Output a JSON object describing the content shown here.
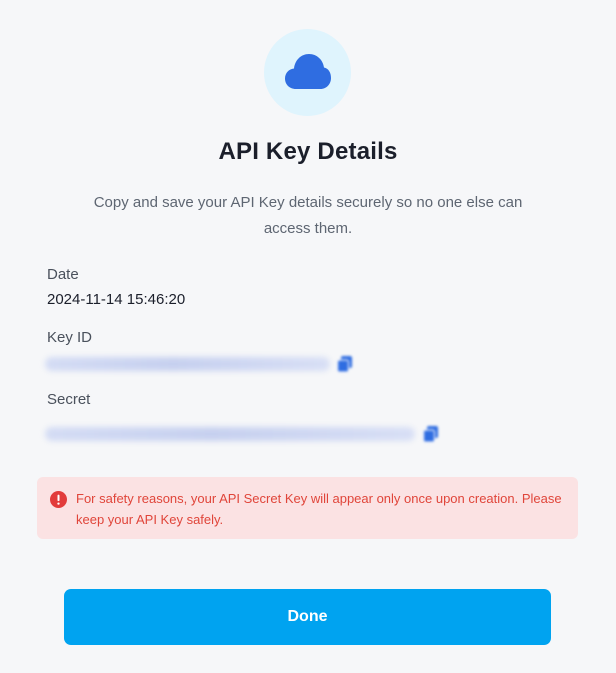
{
  "dialog": {
    "icon": "cloud-icon",
    "title": "API Key Details",
    "subtitle": "Copy and save your API Key details securely so no one else can access them.",
    "fields": {
      "date": {
        "label": "Date",
        "value": "2024-11-14 15:46:20"
      },
      "key_id": {
        "label": "Key ID",
        "copy_icon": "copy-icon"
      },
      "secret": {
        "label": "Secret",
        "copy_icon": "copy-icon"
      }
    },
    "alert": {
      "icon": "exclamation-circle-icon",
      "text": "For safety reasons, your API Secret Key will appear only once upon creation. Please keep your API Key safely."
    },
    "done_label": "Done"
  },
  "colors": {
    "accent": "#00a3f0",
    "cloud": "#2f6de1",
    "cloud_badge_bg": "#dff4fd",
    "alert_bg": "#fbe2e3",
    "alert_text": "#e0453a",
    "page_bg": "#f6f7f9"
  }
}
